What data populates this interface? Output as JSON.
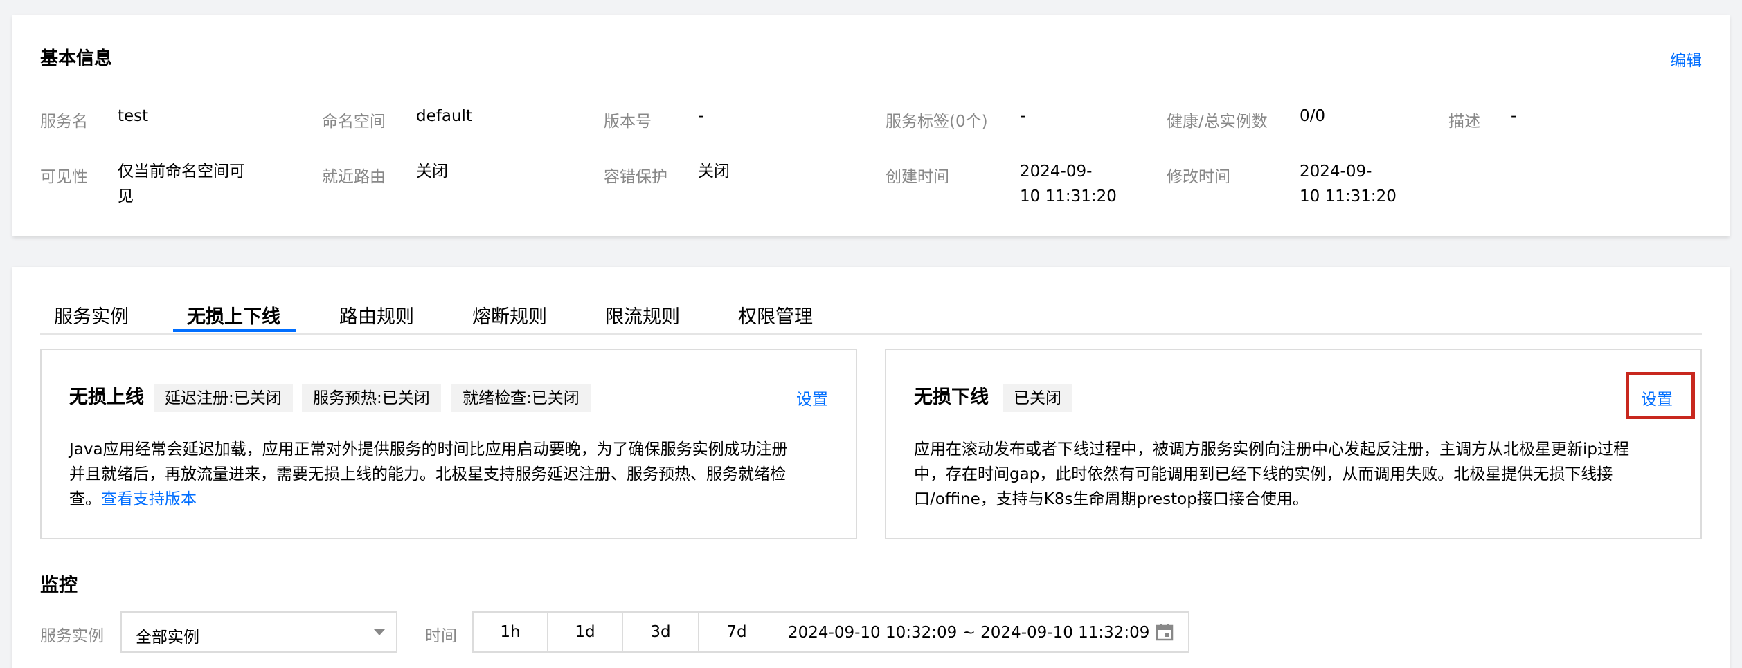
{
  "basic_info": {
    "title": "基本信息",
    "edit_label": "编辑",
    "fields": [
      {
        "label": "服务名",
        "value": "test"
      },
      {
        "label": "命名空间",
        "value": "default"
      },
      {
        "label": "版本号",
        "value": "-"
      },
      {
        "label": "服务标签(0个)",
        "value": "-"
      },
      {
        "label": "健康/总实例数",
        "value": "0/0"
      },
      {
        "label": "描述",
        "value": "-"
      },
      {
        "label": "可见性",
        "value_line1": "仅当前命名空间可",
        "value_line2": "见"
      },
      {
        "label": "就近路由",
        "value": "关闭"
      },
      {
        "label": "容错保护",
        "value": "关闭"
      },
      {
        "label": "创建时间",
        "value_line1": "2024-09-",
        "value_line2": "10 11:31:20"
      },
      {
        "label": "修改时间",
        "value_line1": "2024-09-",
        "value_line2": "10 11:31:20"
      }
    ]
  },
  "tabs": [
    "服务实例",
    "无损上下线",
    "路由规则",
    "熔断规则",
    "限流规则",
    "权限管理"
  ],
  "active_tab": "无损上下线",
  "online_panel": {
    "title": "无损上线",
    "tags": [
      "延迟注册:已关闭",
      "服务预热:已关闭",
      "就绪检查:已关闭"
    ],
    "setting_label": "设置",
    "desc_line1": "Java应用经常会延迟加载，应用正常对外提供服务的时间比应用启动要晚，为了确保服务实例成功注册",
    "desc_line2": "并且就绪后，再放流量进来，需要无损上线的能力。北极星支持服务延迟注册、服务预热、服务就绪检",
    "desc_line3_prefix": "查。",
    "desc_link": "查看支持版本"
  },
  "offline_panel": {
    "title": "无损下线",
    "tag": "已关闭",
    "setting_label": "设置",
    "desc_line1": "应用在滚动发布或者下线过程中，被调方服务实例向注册中心发起反注册，主调方从北极星更新ip过程",
    "desc_line2": "中，存在时间gap，此时依然有可能调用到已经下线的实例，从而调用失败。北极星提供无损下线接",
    "desc_line3": "口/offine，支持与K8s生命周期prestop接口接合使用。"
  },
  "monitor": {
    "title": "监控",
    "instance_label": "服务实例",
    "instance_value": "全部实例",
    "time_label": "时间",
    "time_options": [
      "1h",
      "1d",
      "3d",
      "7d"
    ],
    "range_text": "2024-09-10 10:32:09 ~ 2024-09-10 11:32:09"
  },
  "colors": {
    "link": "#006eff",
    "highlight": "#c8281e"
  }
}
